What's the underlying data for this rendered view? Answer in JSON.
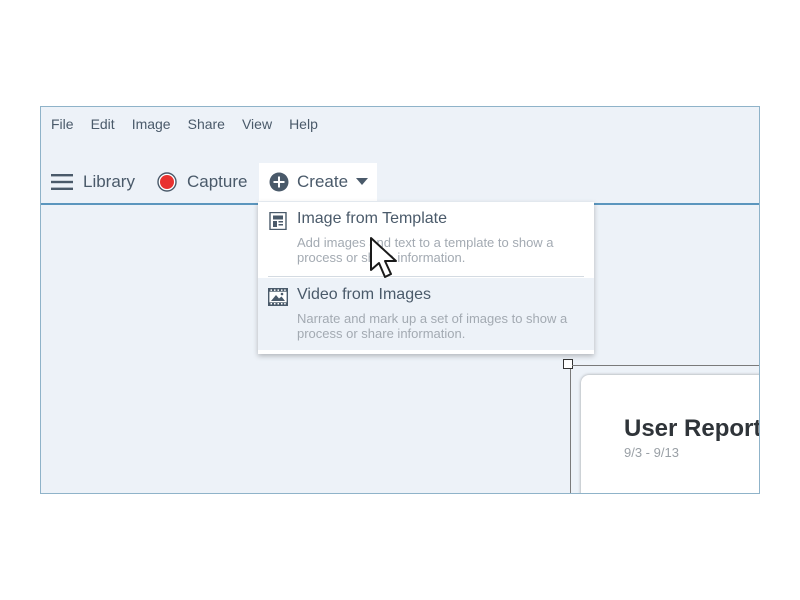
{
  "menubar": {
    "items": [
      "File",
      "Edit",
      "Image",
      "Share",
      "View",
      "Help"
    ]
  },
  "toolbar": {
    "library": {
      "label": "Library",
      "icon": "hamburger-menu-icon"
    },
    "capture": {
      "label": "Capture",
      "icon": "record-icon",
      "color": "#e8312f"
    },
    "create": {
      "label": "Create",
      "icon": "plus-circle-icon"
    }
  },
  "dropdown": {
    "items": [
      {
        "title": "Image from Template",
        "description": "Add images and text to a template to show a process or share information.",
        "icon": "template-icon"
      },
      {
        "title": "Video from Images",
        "description": "Narrate and mark up a set of images to show a process or share information.",
        "icon": "filmstrip-icon"
      }
    ]
  },
  "canvas": {
    "report": {
      "title": "User Report",
      "date_range": "9/3 - 9/13"
    }
  },
  "colors": {
    "accent": "#5b96be",
    "background": "#edf2f8",
    "text": "#4a5a6a"
  }
}
